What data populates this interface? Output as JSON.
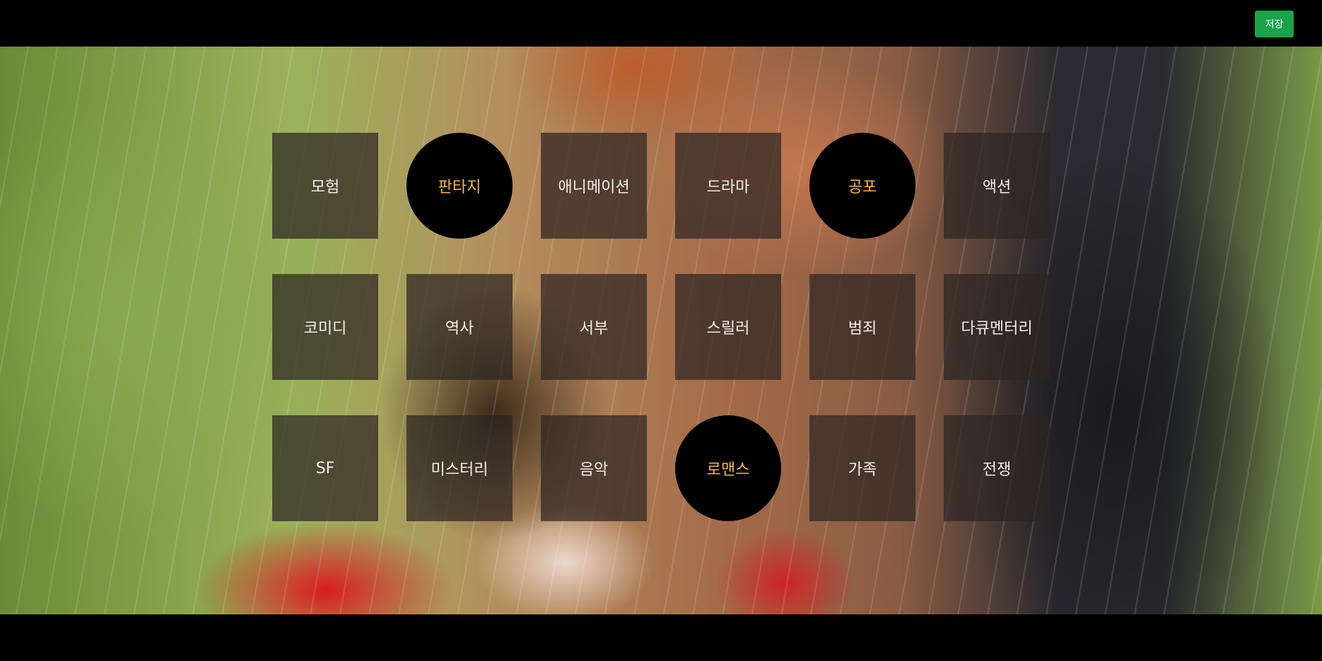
{
  "toolbar": {
    "save_label": "저장"
  },
  "genres": [
    {
      "label": "모험",
      "selected": false
    },
    {
      "label": "판타지",
      "selected": true
    },
    {
      "label": "애니메이션",
      "selected": false
    },
    {
      "label": "드라마",
      "selected": false
    },
    {
      "label": "공포",
      "selected": true
    },
    {
      "label": "액션",
      "selected": false
    },
    {
      "label": "코미디",
      "selected": false
    },
    {
      "label": "역사",
      "selected": false
    },
    {
      "label": "서부",
      "selected": false
    },
    {
      "label": "스릴러",
      "selected": false
    },
    {
      "label": "범죄",
      "selected": false
    },
    {
      "label": "다큐멘터리",
      "selected": false
    },
    {
      "label": "SF",
      "selected": false
    },
    {
      "label": "미스터리",
      "selected": false
    },
    {
      "label": "음악",
      "selected": false
    },
    {
      "label": "로맨스",
      "selected": true
    },
    {
      "label": "가족",
      "selected": false
    },
    {
      "label": "전쟁",
      "selected": false
    }
  ],
  "colors": {
    "selected_text": "#f2b94a",
    "save_button": "#1aa34a"
  }
}
